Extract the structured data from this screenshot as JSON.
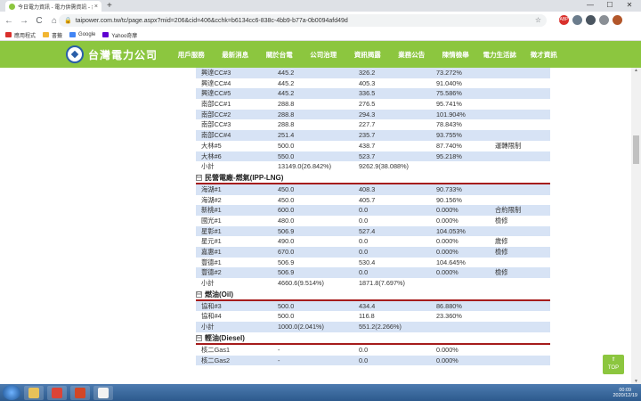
{
  "browser": {
    "tab_title": "今日電力資訊 - 電力供需資訊 - 台",
    "tab_close": "×",
    "new_tab": "+",
    "window_buttons": [
      "—",
      "☐",
      "✕"
    ],
    "back": "←",
    "forward": "→",
    "reload": "C",
    "home": "⌂",
    "lock": "🔒",
    "url": "taipower.com.tw/tc/page.aspx?mid=206&cid=406&cchk=b6134cc6-838c-4bb9-b77a-0b0094afd49d",
    "star": "☆",
    "extensions": [
      {
        "label": "ABP",
        "color": "#d9302c"
      },
      {
        "label": "",
        "color": "#6b7c8c"
      },
      {
        "label": "",
        "color": "#4a5560"
      },
      {
        "label": "",
        "color": "#8a8f95"
      },
      {
        "label": "",
        "color": "#b2562a"
      }
    ],
    "bookmarks": [
      {
        "label": "應用程式",
        "icon_color": "#d9302c"
      },
      {
        "label": "書籤",
        "icon_color": "#f2b632"
      },
      {
        "label": "Google",
        "icon_color": "#4285f4"
      },
      {
        "label": "Yahoo奇摩",
        "icon_color": "#5f01d1"
      }
    ]
  },
  "site": {
    "logo_text": "台灣電力公司",
    "menu": [
      "用戶服務",
      "最新消息",
      "關於台電",
      "公司治理",
      "資訊揭露",
      "業務公告",
      "陳情檢舉",
      "電力生活誌",
      "徵才資訊"
    ]
  },
  "rows_top": [
    {
      "name": "興達CC#3",
      "cap": "445.2",
      "gen": "326.2",
      "pct": "73.272%",
      "note": "",
      "alt": true
    },
    {
      "name": "興達CC#4",
      "cap": "445.2",
      "gen": "405.3",
      "pct": "91.040%",
      "note": "",
      "alt": false
    },
    {
      "name": "興達CC#5",
      "cap": "445.2",
      "gen": "336.5",
      "pct": "75.586%",
      "note": "",
      "alt": true
    },
    {
      "name": "南部CC#1",
      "cap": "288.8",
      "gen": "276.5",
      "pct": "95.741%",
      "note": "",
      "alt": false
    },
    {
      "name": "南部CC#2",
      "cap": "288.8",
      "gen": "294.3",
      "pct": "101.904%",
      "note": "",
      "alt": true
    },
    {
      "name": "南部CC#3",
      "cap": "288.8",
      "gen": "227.7",
      "pct": "78.843%",
      "note": "",
      "alt": false
    },
    {
      "name": "南部CC#4",
      "cap": "251.4",
      "gen": "235.7",
      "pct": "93.755%",
      "note": "",
      "alt": true
    },
    {
      "name": "大林#5",
      "cap": "500.0",
      "gen": "438.7",
      "pct": "87.740%",
      "note": "運轉限制",
      "alt": false
    },
    {
      "name": "大林#6",
      "cap": "550.0",
      "gen": "523.7",
      "pct": "95.218%",
      "note": "",
      "alt": true
    },
    {
      "name": "小計",
      "cap": "13149.0(26.842%)",
      "gen": "9262.9(38.088%)",
      "pct": "",
      "note": "",
      "alt": false
    }
  ],
  "section_lng": "民營電廠-燃氣(IPP-LNG)",
  "rows_lng": [
    {
      "name": "海湖#1",
      "cap": "450.0",
      "gen": "408.3",
      "pct": "90.733%",
      "note": "",
      "alt": true
    },
    {
      "name": "海湖#2",
      "cap": "450.0",
      "gen": "405.7",
      "pct": "90.156%",
      "note": "",
      "alt": false
    },
    {
      "name": "新桃#1",
      "cap": "600.0",
      "gen": "0.0",
      "pct": "0.000%",
      "note": "合約限制",
      "alt": true
    },
    {
      "name": "國光#1",
      "cap": "480.0",
      "gen": "0.0",
      "pct": "0.000%",
      "note": "檢修",
      "alt": false
    },
    {
      "name": "星彰#1",
      "cap": "506.9",
      "gen": "527.4",
      "pct": "104.053%",
      "note": "",
      "alt": true
    },
    {
      "name": "星元#1",
      "cap": "490.0",
      "gen": "0.0",
      "pct": "0.000%",
      "note": "歲修",
      "alt": false
    },
    {
      "name": "嘉惠#1",
      "cap": "670.0",
      "gen": "0.0",
      "pct": "0.000%",
      "note": "檢修",
      "alt": true
    },
    {
      "name": "豐德#1",
      "cap": "506.9",
      "gen": "530.4",
      "pct": "104.645%",
      "note": "",
      "alt": false
    },
    {
      "name": "豐德#2",
      "cap": "506.9",
      "gen": "0.0",
      "pct": "0.000%",
      "note": "檢修",
      "alt": true
    },
    {
      "name": "小計",
      "cap": "4660.6(9.514%)",
      "gen": "1871.8(7.697%)",
      "pct": "",
      "note": "",
      "alt": false
    }
  ],
  "section_oil": "燃油(Oil)",
  "rows_oil": [
    {
      "name": "協和#3",
      "cap": "500.0",
      "gen": "434.4",
      "pct": "86.880%",
      "note": "",
      "alt": true
    },
    {
      "name": "協和#4",
      "cap": "500.0",
      "gen": "116.8",
      "pct": "23.360%",
      "note": "",
      "alt": false
    },
    {
      "name": "小計",
      "cap": "1000.0(2.041%)",
      "gen": "551.2(2.266%)",
      "pct": "",
      "note": "",
      "alt": true
    }
  ],
  "section_diesel": "輕油(Diesel)",
  "rows_diesel": [
    {
      "name": "核二Gas1",
      "cap": "-",
      "gen": "0.0",
      "pct": "0.000%",
      "note": "",
      "alt": false
    },
    {
      "name": "核二Gas2",
      "cap": "-",
      "gen": "0.0",
      "pct": "0.000%",
      "note": "",
      "alt": true
    }
  ],
  "section_toggle": "⊟",
  "top_button": {
    "arrow": "⇑",
    "label": "TOP"
  },
  "scroll_up": "▲",
  "scroll_down": "▼",
  "taskbar": {
    "items": [
      {
        "icon": "folder-icon",
        "color": "#e8c25a"
      },
      {
        "icon": "chrome-icon",
        "color": "#db4437"
      },
      {
        "icon": "powerpoint-icon",
        "color": "#d24726"
      },
      {
        "icon": "paint-icon",
        "color": "#f2f2f2"
      }
    ],
    "time": "00:09",
    "date": "2020/12/19"
  }
}
